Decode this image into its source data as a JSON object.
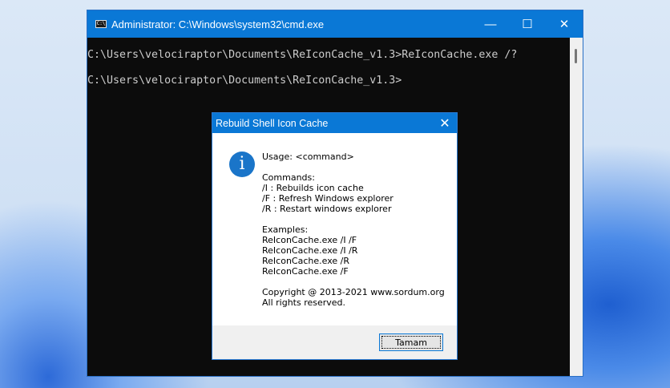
{
  "cmd": {
    "title": "Administrator: C:\\Windows\\system32\\cmd.exe",
    "icon_text": "C:\\",
    "lines": [
      "C:\\Users\\velociraptor\\Documents\\ReIconCache_v1.3>ReIconCache.exe /?",
      "C:\\Users\\velociraptor\\Documents\\ReIconCache_v1.3>"
    ],
    "minimize": "—",
    "maximize": "☐",
    "close": "✕"
  },
  "dialog": {
    "title": "Rebuild Shell Icon Cache",
    "close": "✕",
    "icon": "i",
    "usage": "Usage: <command>",
    "commands_header": "Commands:",
    "commands": [
      "/I : Rebuilds icon cache",
      "/F : Refresh Windows explorer",
      "/R : Restart windows explorer"
    ],
    "examples_header": "Examples:",
    "examples": [
      "ReIconCache.exe /I /F",
      "ReIconCache.exe /I /R",
      "ReIconCache.exe /R",
      "ReIconCache.exe /F"
    ],
    "copyright": "Copyright @ 2013-2021 www.sordum.org",
    "rights": "All rights reserved.",
    "ok_label": "Tamam"
  }
}
